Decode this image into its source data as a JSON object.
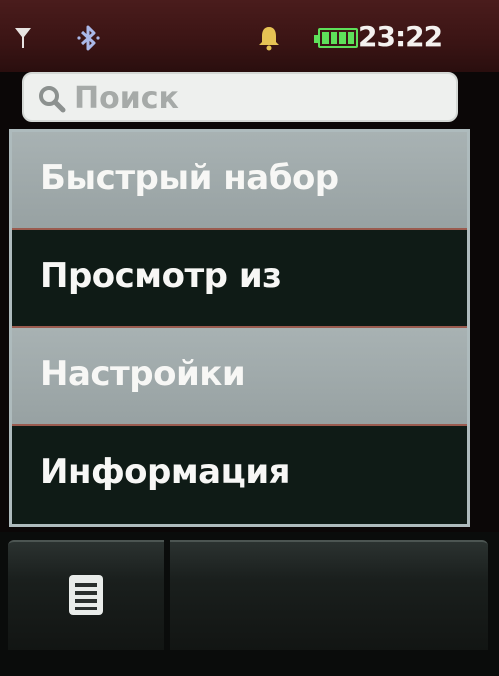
{
  "status_bar": {
    "time": "23:22",
    "battery_level": 1.0,
    "icons": [
      "signal-antenna-icon",
      "bluetooth-icon",
      "alarm-bell-icon",
      "battery-icon"
    ]
  },
  "search": {
    "placeholder": "Поиск",
    "icon": "search-icon"
  },
  "menu": {
    "items": [
      {
        "label": "Быстрый набор"
      },
      {
        "label": "Просмотр из"
      },
      {
        "label": "Настройки"
      },
      {
        "label": "Информация"
      }
    ]
  },
  "softkeys": {
    "left_icon": "menu-list-icon"
  },
  "colors": {
    "status_bar_bg": "#3a1414",
    "menu_light_bg": "#a0aaab",
    "menu_dark_bg": "#0f1b16",
    "battery": "#5ee05a",
    "separator": "#9a5b4f"
  }
}
